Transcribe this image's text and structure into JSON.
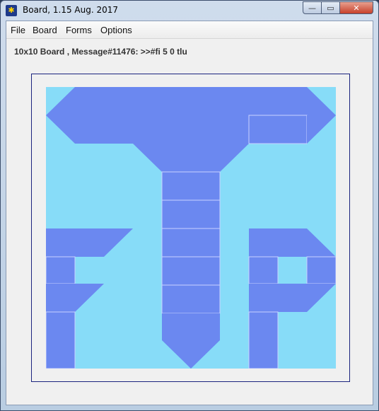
{
  "window": {
    "title": "Board, 1.15 Aug. 2017",
    "controls": {
      "minimize": "—",
      "maximize": "▭",
      "close": "✕"
    }
  },
  "menu": [
    "File",
    "Board",
    "Forms",
    "Options"
  ],
  "header": "10x10 Board , Message#11476: >>#fi 5 0 tlu",
  "board": {
    "columns": 10,
    "rows": 10,
    "background_color": "#87dcf8",
    "form_color": "#6b88f0",
    "cell_border_color": "#c8d2ff"
  }
}
